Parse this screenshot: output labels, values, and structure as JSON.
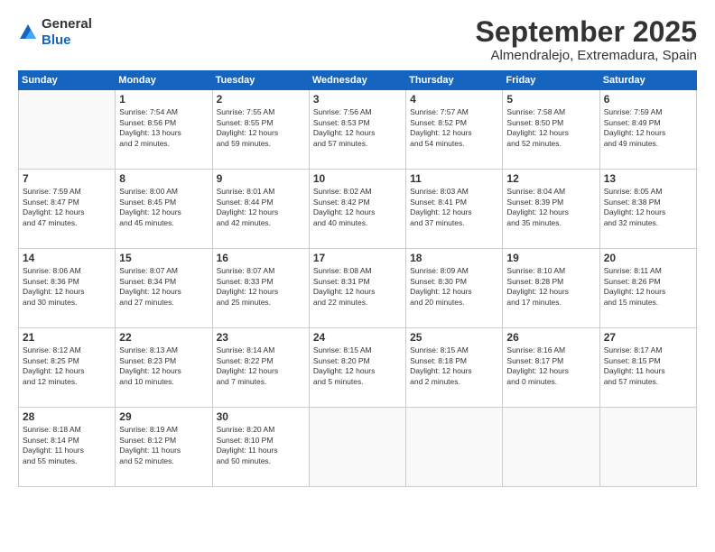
{
  "logo": {
    "general": "General",
    "blue": "Blue"
  },
  "title": {
    "month": "September 2025",
    "location": "Almendralejo, Extremadura, Spain"
  },
  "days_of_week": [
    "Sunday",
    "Monday",
    "Tuesday",
    "Wednesday",
    "Thursday",
    "Friday",
    "Saturday"
  ],
  "weeks": [
    [
      {
        "day": "",
        "info": ""
      },
      {
        "day": "1",
        "info": "Sunrise: 7:54 AM\nSunset: 8:56 PM\nDaylight: 13 hours\nand 2 minutes."
      },
      {
        "day": "2",
        "info": "Sunrise: 7:55 AM\nSunset: 8:55 PM\nDaylight: 12 hours\nand 59 minutes."
      },
      {
        "day": "3",
        "info": "Sunrise: 7:56 AM\nSunset: 8:53 PM\nDaylight: 12 hours\nand 57 minutes."
      },
      {
        "day": "4",
        "info": "Sunrise: 7:57 AM\nSunset: 8:52 PM\nDaylight: 12 hours\nand 54 minutes."
      },
      {
        "day": "5",
        "info": "Sunrise: 7:58 AM\nSunset: 8:50 PM\nDaylight: 12 hours\nand 52 minutes."
      },
      {
        "day": "6",
        "info": "Sunrise: 7:59 AM\nSunset: 8:49 PM\nDaylight: 12 hours\nand 49 minutes."
      }
    ],
    [
      {
        "day": "7",
        "info": "Sunrise: 7:59 AM\nSunset: 8:47 PM\nDaylight: 12 hours\nand 47 minutes."
      },
      {
        "day": "8",
        "info": "Sunrise: 8:00 AM\nSunset: 8:45 PM\nDaylight: 12 hours\nand 45 minutes."
      },
      {
        "day": "9",
        "info": "Sunrise: 8:01 AM\nSunset: 8:44 PM\nDaylight: 12 hours\nand 42 minutes."
      },
      {
        "day": "10",
        "info": "Sunrise: 8:02 AM\nSunset: 8:42 PM\nDaylight: 12 hours\nand 40 minutes."
      },
      {
        "day": "11",
        "info": "Sunrise: 8:03 AM\nSunset: 8:41 PM\nDaylight: 12 hours\nand 37 minutes."
      },
      {
        "day": "12",
        "info": "Sunrise: 8:04 AM\nSunset: 8:39 PM\nDaylight: 12 hours\nand 35 minutes."
      },
      {
        "day": "13",
        "info": "Sunrise: 8:05 AM\nSunset: 8:38 PM\nDaylight: 12 hours\nand 32 minutes."
      }
    ],
    [
      {
        "day": "14",
        "info": "Sunrise: 8:06 AM\nSunset: 8:36 PM\nDaylight: 12 hours\nand 30 minutes."
      },
      {
        "day": "15",
        "info": "Sunrise: 8:07 AM\nSunset: 8:34 PM\nDaylight: 12 hours\nand 27 minutes."
      },
      {
        "day": "16",
        "info": "Sunrise: 8:07 AM\nSunset: 8:33 PM\nDaylight: 12 hours\nand 25 minutes."
      },
      {
        "day": "17",
        "info": "Sunrise: 8:08 AM\nSunset: 8:31 PM\nDaylight: 12 hours\nand 22 minutes."
      },
      {
        "day": "18",
        "info": "Sunrise: 8:09 AM\nSunset: 8:30 PM\nDaylight: 12 hours\nand 20 minutes."
      },
      {
        "day": "19",
        "info": "Sunrise: 8:10 AM\nSunset: 8:28 PM\nDaylight: 12 hours\nand 17 minutes."
      },
      {
        "day": "20",
        "info": "Sunrise: 8:11 AM\nSunset: 8:26 PM\nDaylight: 12 hours\nand 15 minutes."
      }
    ],
    [
      {
        "day": "21",
        "info": "Sunrise: 8:12 AM\nSunset: 8:25 PM\nDaylight: 12 hours\nand 12 minutes."
      },
      {
        "day": "22",
        "info": "Sunrise: 8:13 AM\nSunset: 8:23 PM\nDaylight: 12 hours\nand 10 minutes."
      },
      {
        "day": "23",
        "info": "Sunrise: 8:14 AM\nSunset: 8:22 PM\nDaylight: 12 hours\nand 7 minutes."
      },
      {
        "day": "24",
        "info": "Sunrise: 8:15 AM\nSunset: 8:20 PM\nDaylight: 12 hours\nand 5 minutes."
      },
      {
        "day": "25",
        "info": "Sunrise: 8:15 AM\nSunset: 8:18 PM\nDaylight: 12 hours\nand 2 minutes."
      },
      {
        "day": "26",
        "info": "Sunrise: 8:16 AM\nSunset: 8:17 PM\nDaylight: 12 hours\nand 0 minutes."
      },
      {
        "day": "27",
        "info": "Sunrise: 8:17 AM\nSunset: 8:15 PM\nDaylight: 11 hours\nand 57 minutes."
      }
    ],
    [
      {
        "day": "28",
        "info": "Sunrise: 8:18 AM\nSunset: 8:14 PM\nDaylight: 11 hours\nand 55 minutes."
      },
      {
        "day": "29",
        "info": "Sunrise: 8:19 AM\nSunset: 8:12 PM\nDaylight: 11 hours\nand 52 minutes."
      },
      {
        "day": "30",
        "info": "Sunrise: 8:20 AM\nSunset: 8:10 PM\nDaylight: 11 hours\nand 50 minutes."
      },
      {
        "day": "",
        "info": ""
      },
      {
        "day": "",
        "info": ""
      },
      {
        "day": "",
        "info": ""
      },
      {
        "day": "",
        "info": ""
      }
    ]
  ]
}
